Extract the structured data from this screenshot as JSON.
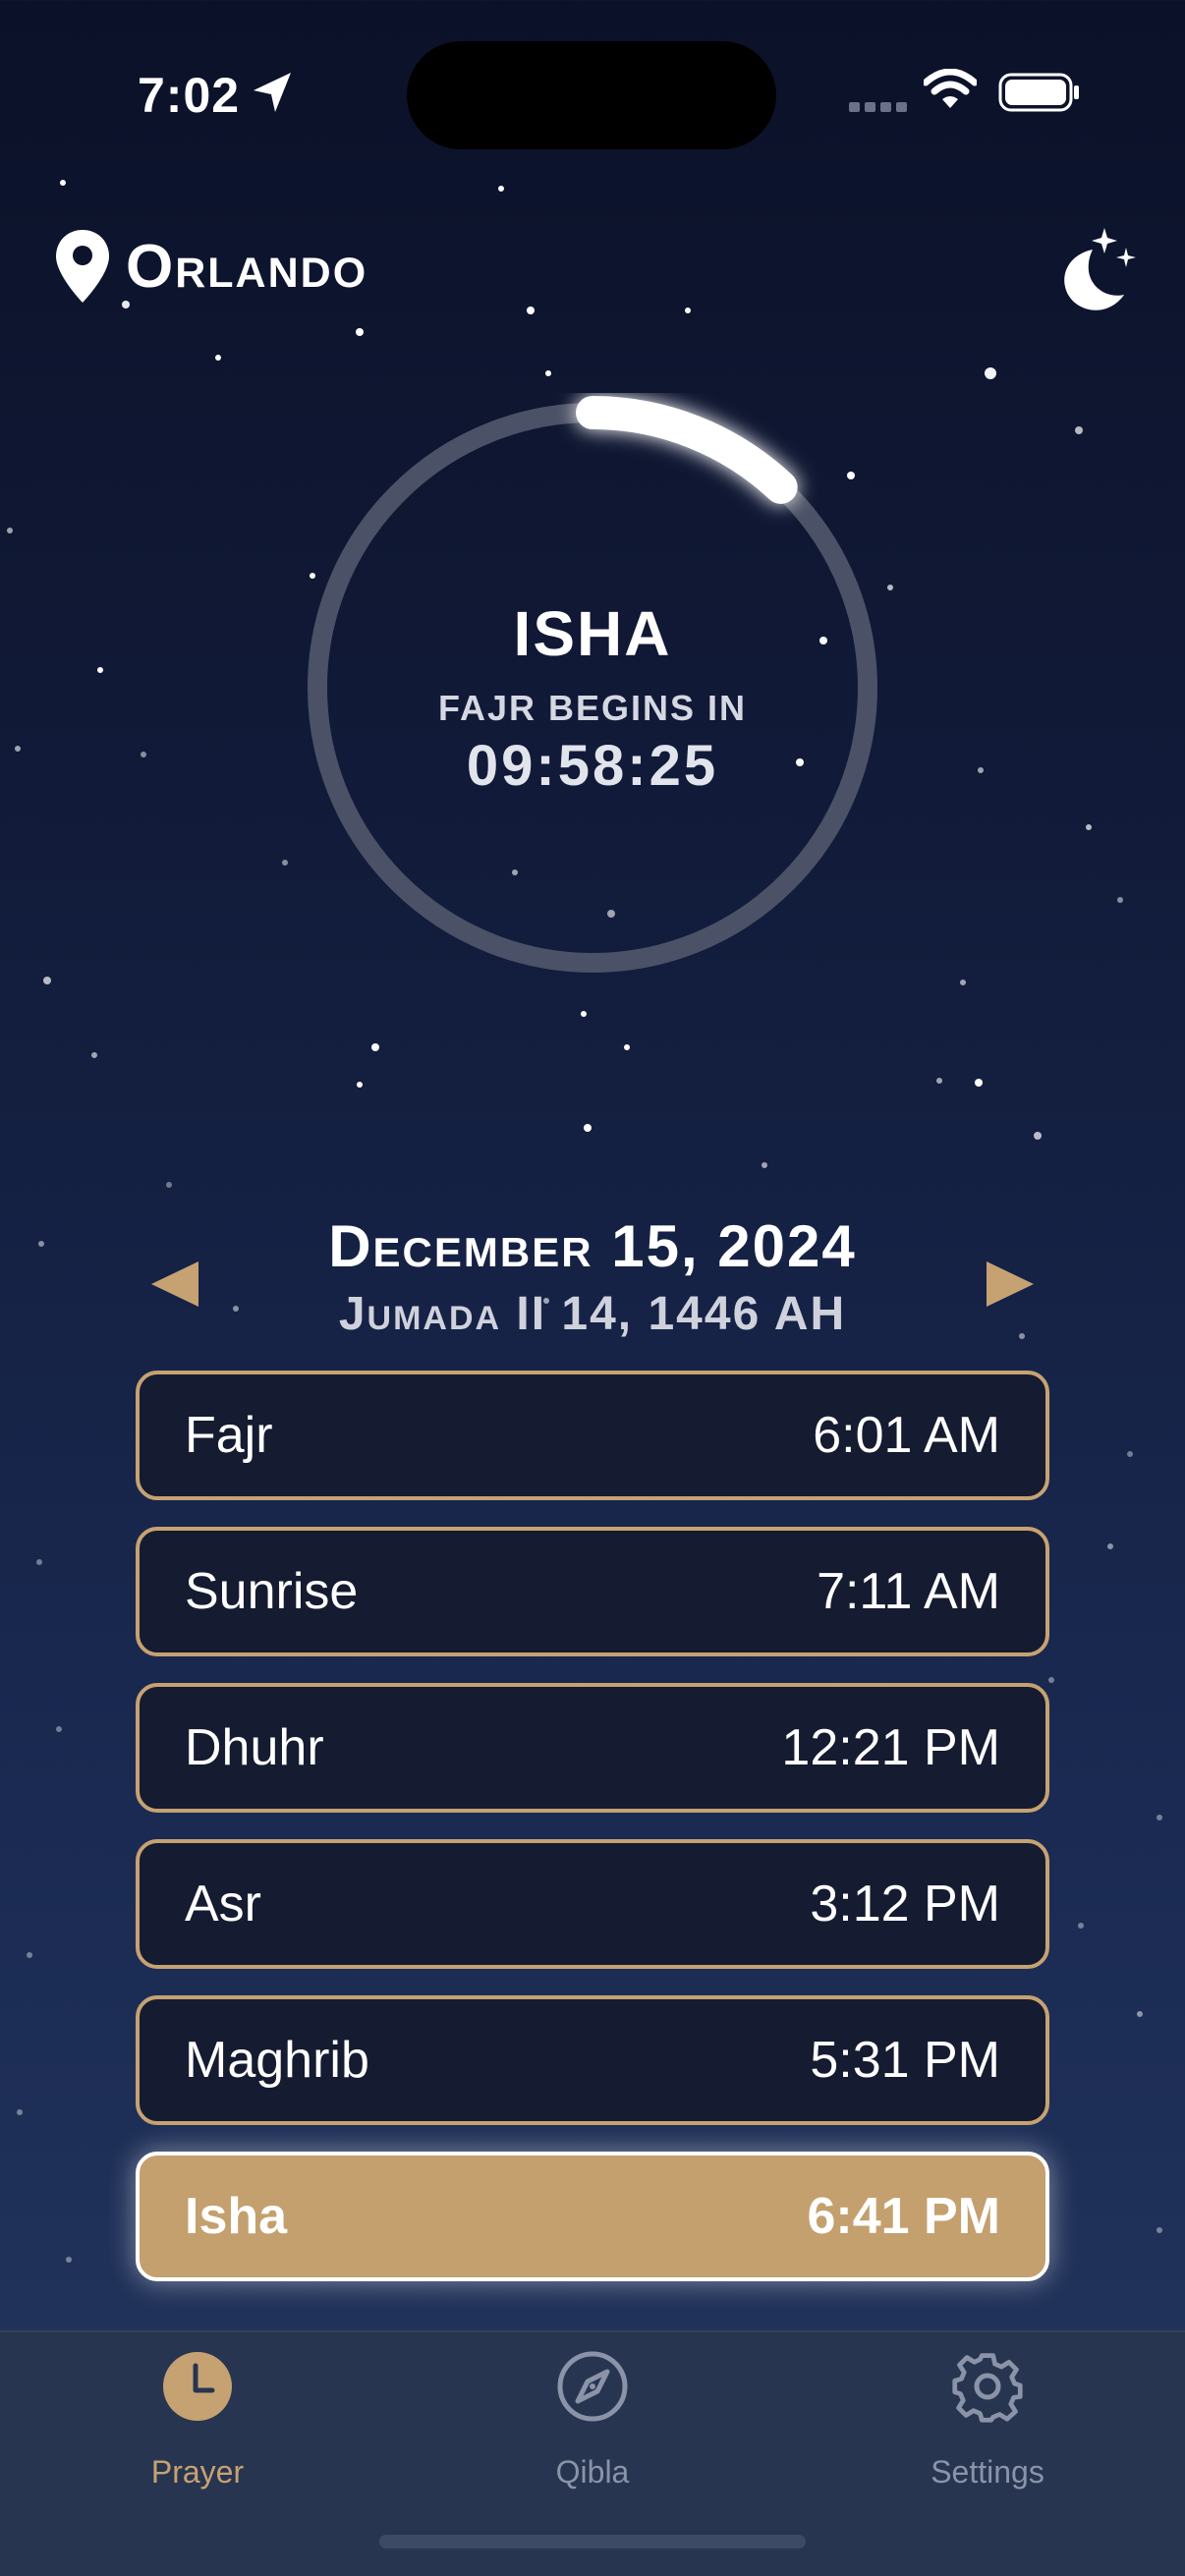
{
  "status_bar": {
    "time": "7:02",
    "icons": [
      "location-arrow-icon",
      "cellular-signal-icon",
      "wifi-icon",
      "battery-icon"
    ]
  },
  "header": {
    "location": "Orlando",
    "location_icon": "map-pin-icon",
    "theme_icon": "moon-stars-icon"
  },
  "countdown": {
    "current_prayer": "ISHA",
    "label": "FAJR BEGINS IN",
    "time_remaining": "09:58:25",
    "progress": 0.12
  },
  "date": {
    "gregorian": "December 15, 2024",
    "hijri": "Jumada II 14, 1446 AH",
    "prev_icon": "triangle-left-icon",
    "next_icon": "triangle-right-icon"
  },
  "prayers": [
    {
      "name": "Fajr",
      "time": "6:01 AM",
      "active": false
    },
    {
      "name": "Sunrise",
      "time": "7:11 AM",
      "active": false
    },
    {
      "name": "Dhuhr",
      "time": "12:21 PM",
      "active": false
    },
    {
      "name": "Asr",
      "time": "3:12 PM",
      "active": false
    },
    {
      "name": "Maghrib",
      "time": "5:31 PM",
      "active": false
    },
    {
      "name": "Isha",
      "time": "6:41 PM",
      "active": true
    }
  ],
  "tabs": [
    {
      "label": "Prayer",
      "icon": "clock-icon",
      "selected": true
    },
    {
      "label": "Qibla",
      "icon": "compass-icon",
      "selected": false
    },
    {
      "label": "Settings",
      "icon": "gear-icon",
      "selected": false
    }
  ],
  "colors": {
    "accent_gold": "#c6a272",
    "active_row": "#c4a06e",
    "row_background": "#151b30",
    "sky_top": "#0b1128",
    "sky_bottom": "#24365e"
  }
}
